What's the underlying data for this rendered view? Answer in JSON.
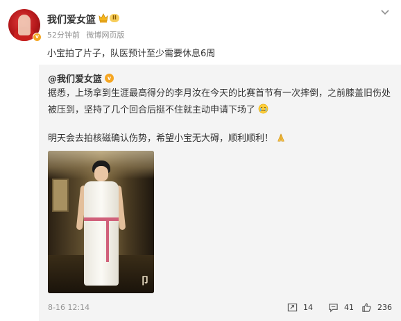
{
  "header": {
    "username": "我们爱女篮",
    "level_badge": "II",
    "time": "52分钟前",
    "source": "微博网页版"
  },
  "post": {
    "text": "小宝拍了片子，队医预计至少需要休息6周"
  },
  "repost": {
    "author": "@我们爱女篮",
    "paragraph1": "据悉，上场拿到生涯最高得分的李月汝在今天的比赛首节有一次摔倒，之前膝盖旧伤处被压到，坚持了几个回合后挺不住就主动申请下场了",
    "paragraph2": "明天会去拍核磁确认伤势，希望小宝无大碍，顺利顺利！",
    "date": "8-16 12:14",
    "actions": {
      "forward_count": "14",
      "comment_count": "41",
      "like_count": "236"
    }
  },
  "icons": {
    "more": "chevron-down-icon",
    "crown": "crown-icon",
    "verified": "verified-icon",
    "crying": "crying-emoji-icon",
    "pray": "pray-emoji-icon",
    "forward": "forward-icon",
    "comment": "comment-icon",
    "like": "thumbs-up-icon"
  },
  "colors": {
    "repost_background": "#f4f4f4",
    "meta_text": "#939393",
    "verified_orange": "#f5a623"
  }
}
